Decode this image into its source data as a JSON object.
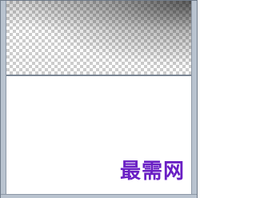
{
  "watermark": {
    "text": "最需网",
    "color": "#6a1fc4"
  },
  "colors": {
    "frame": "#b9c3cf",
    "checker_light": "#ffffff",
    "checker_dark": "#cccccc",
    "divider": "#7a8593"
  }
}
